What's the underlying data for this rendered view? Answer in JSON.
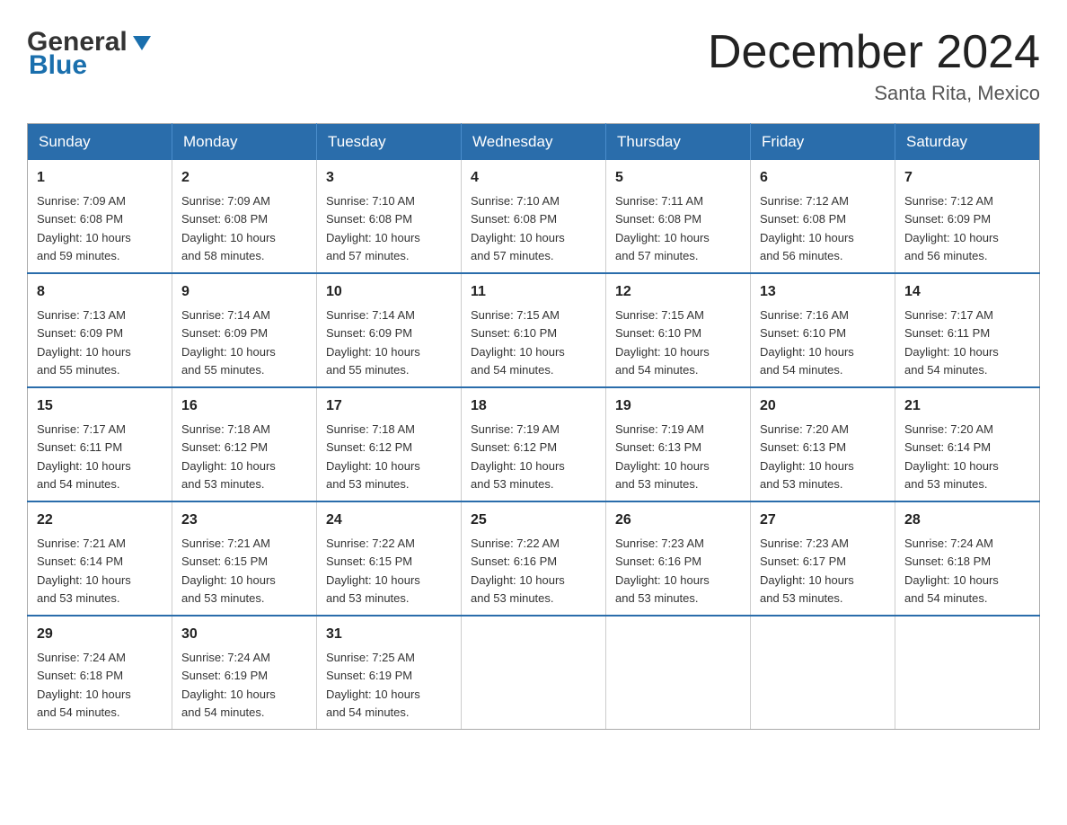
{
  "header": {
    "logo_general": "General",
    "logo_blue": "Blue",
    "month_title": "December 2024",
    "location": "Santa Rita, Mexico"
  },
  "days_of_week": [
    "Sunday",
    "Monday",
    "Tuesday",
    "Wednesday",
    "Thursday",
    "Friday",
    "Saturday"
  ],
  "weeks": [
    [
      {
        "day": "1",
        "sunrise": "7:09 AM",
        "sunset": "6:08 PM",
        "daylight": "10 hours and 59 minutes."
      },
      {
        "day": "2",
        "sunrise": "7:09 AM",
        "sunset": "6:08 PM",
        "daylight": "10 hours and 58 minutes."
      },
      {
        "day": "3",
        "sunrise": "7:10 AM",
        "sunset": "6:08 PM",
        "daylight": "10 hours and 57 minutes."
      },
      {
        "day": "4",
        "sunrise": "7:10 AM",
        "sunset": "6:08 PM",
        "daylight": "10 hours and 57 minutes."
      },
      {
        "day": "5",
        "sunrise": "7:11 AM",
        "sunset": "6:08 PM",
        "daylight": "10 hours and 57 minutes."
      },
      {
        "day": "6",
        "sunrise": "7:12 AM",
        "sunset": "6:08 PM",
        "daylight": "10 hours and 56 minutes."
      },
      {
        "day": "7",
        "sunrise": "7:12 AM",
        "sunset": "6:09 PM",
        "daylight": "10 hours and 56 minutes."
      }
    ],
    [
      {
        "day": "8",
        "sunrise": "7:13 AM",
        "sunset": "6:09 PM",
        "daylight": "10 hours and 55 minutes."
      },
      {
        "day": "9",
        "sunrise": "7:14 AM",
        "sunset": "6:09 PM",
        "daylight": "10 hours and 55 minutes."
      },
      {
        "day": "10",
        "sunrise": "7:14 AM",
        "sunset": "6:09 PM",
        "daylight": "10 hours and 55 minutes."
      },
      {
        "day": "11",
        "sunrise": "7:15 AM",
        "sunset": "6:10 PM",
        "daylight": "10 hours and 54 minutes."
      },
      {
        "day": "12",
        "sunrise": "7:15 AM",
        "sunset": "6:10 PM",
        "daylight": "10 hours and 54 minutes."
      },
      {
        "day": "13",
        "sunrise": "7:16 AM",
        "sunset": "6:10 PM",
        "daylight": "10 hours and 54 minutes."
      },
      {
        "day": "14",
        "sunrise": "7:17 AM",
        "sunset": "6:11 PM",
        "daylight": "10 hours and 54 minutes."
      }
    ],
    [
      {
        "day": "15",
        "sunrise": "7:17 AM",
        "sunset": "6:11 PM",
        "daylight": "10 hours and 54 minutes."
      },
      {
        "day": "16",
        "sunrise": "7:18 AM",
        "sunset": "6:12 PM",
        "daylight": "10 hours and 53 minutes."
      },
      {
        "day": "17",
        "sunrise": "7:18 AM",
        "sunset": "6:12 PM",
        "daylight": "10 hours and 53 minutes."
      },
      {
        "day": "18",
        "sunrise": "7:19 AM",
        "sunset": "6:12 PM",
        "daylight": "10 hours and 53 minutes."
      },
      {
        "day": "19",
        "sunrise": "7:19 AM",
        "sunset": "6:13 PM",
        "daylight": "10 hours and 53 minutes."
      },
      {
        "day": "20",
        "sunrise": "7:20 AM",
        "sunset": "6:13 PM",
        "daylight": "10 hours and 53 minutes."
      },
      {
        "day": "21",
        "sunrise": "7:20 AM",
        "sunset": "6:14 PM",
        "daylight": "10 hours and 53 minutes."
      }
    ],
    [
      {
        "day": "22",
        "sunrise": "7:21 AM",
        "sunset": "6:14 PM",
        "daylight": "10 hours and 53 minutes."
      },
      {
        "day": "23",
        "sunrise": "7:21 AM",
        "sunset": "6:15 PM",
        "daylight": "10 hours and 53 minutes."
      },
      {
        "day": "24",
        "sunrise": "7:22 AM",
        "sunset": "6:15 PM",
        "daylight": "10 hours and 53 minutes."
      },
      {
        "day": "25",
        "sunrise": "7:22 AM",
        "sunset": "6:16 PM",
        "daylight": "10 hours and 53 minutes."
      },
      {
        "day": "26",
        "sunrise": "7:23 AM",
        "sunset": "6:16 PM",
        "daylight": "10 hours and 53 minutes."
      },
      {
        "day": "27",
        "sunrise": "7:23 AM",
        "sunset": "6:17 PM",
        "daylight": "10 hours and 53 minutes."
      },
      {
        "day": "28",
        "sunrise": "7:24 AM",
        "sunset": "6:18 PM",
        "daylight": "10 hours and 54 minutes."
      }
    ],
    [
      {
        "day": "29",
        "sunrise": "7:24 AM",
        "sunset": "6:18 PM",
        "daylight": "10 hours and 54 minutes."
      },
      {
        "day": "30",
        "sunrise": "7:24 AM",
        "sunset": "6:19 PM",
        "daylight": "10 hours and 54 minutes."
      },
      {
        "day": "31",
        "sunrise": "7:25 AM",
        "sunset": "6:19 PM",
        "daylight": "10 hours and 54 minutes."
      },
      null,
      null,
      null,
      null
    ]
  ],
  "labels": {
    "sunrise": "Sunrise:",
    "sunset": "Sunset:",
    "daylight": "Daylight:"
  }
}
